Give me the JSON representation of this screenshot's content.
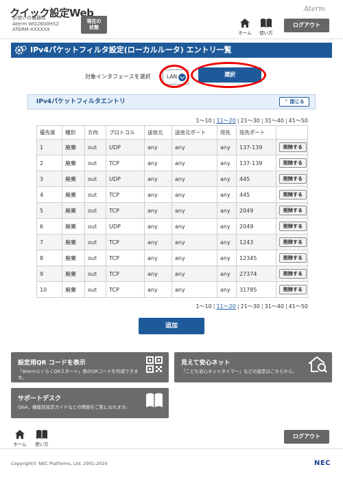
{
  "header": {
    "app_title": "クイック設定Web",
    "device_line1": "お使いの機器は",
    "device_line2": "Aterm WG2600HS2",
    "device_line3": "ATERM-XXXXXX",
    "status_line1": "現在の",
    "status_line2": "状態",
    "brand": "Aterm",
    "home_label": "ホーム",
    "help_label": "使い方",
    "logout_label": "ログアウト"
  },
  "page": {
    "title": "IPv4パケットフィルタ設定(ローカルルータ) エントリ一覧",
    "interface_label": "対象インタフェースを選択",
    "interface_value": "LAN",
    "select_button": "選択"
  },
  "section": {
    "title": "IPv4パケットフィルタエントリ",
    "close_label": "閉じる"
  },
  "pagination": {
    "pages": [
      "1～10",
      "11～20",
      "21～30",
      "31～40",
      "41～50"
    ],
    "linked_index": 1
  },
  "table": {
    "columns": [
      "優先度",
      "種別",
      "方向",
      "プロトコル",
      "送信元",
      "送信元ポート",
      "宛先",
      "宛先ポート",
      ""
    ],
    "delete_label": "削除する",
    "rows": [
      [
        "1",
        "廃棄",
        "out",
        "UDP",
        "any",
        "any",
        "any",
        "137-139"
      ],
      [
        "2",
        "廃棄",
        "out",
        "TCP",
        "any",
        "any",
        "any",
        "137-139"
      ],
      [
        "3",
        "廃棄",
        "out",
        "UDP",
        "any",
        "any",
        "any",
        "445"
      ],
      [
        "4",
        "廃棄",
        "out",
        "TCP",
        "any",
        "any",
        "any",
        "445"
      ],
      [
        "5",
        "廃棄",
        "out",
        "TCP",
        "any",
        "any",
        "any",
        "2049"
      ],
      [
        "6",
        "廃棄",
        "out",
        "UDP",
        "any",
        "any",
        "any",
        "2049"
      ],
      [
        "7",
        "廃棄",
        "out",
        "TCP",
        "any",
        "any",
        "any",
        "1243"
      ],
      [
        "8",
        "廃棄",
        "out",
        "TCP",
        "any",
        "any",
        "any",
        "12345"
      ],
      [
        "9",
        "廃棄",
        "out",
        "TCP",
        "any",
        "any",
        "any",
        "27374"
      ],
      [
        "10",
        "廃棄",
        "out",
        "TCP",
        "any",
        "any",
        "any",
        "31785"
      ]
    ]
  },
  "add_button": "追加",
  "cards": {
    "qr": {
      "title": "設定用QR コードを表示",
      "desc": "「AtermらくらくQRスタート」用のQRコードを作成できます。",
      "icon": "qr-code-icon"
    },
    "safety": {
      "title": "見えて安心ネット",
      "desc": "「こども安心ネットタイマー」などの設定はこちらから。",
      "icon": "house-search-icon"
    },
    "support": {
      "title": "サポートデスク",
      "desc": "Q&A、機能別設定ガイドなどの情報をご覧になれます。",
      "icon": "book-icon"
    }
  },
  "footer": {
    "home_label": "ホーム",
    "help_label": "使い方",
    "logout_label": "ログアウト",
    "copyright": "Copyright© NEC Platforms, Ltd. 2001-2020",
    "logo": "NEC"
  },
  "colors": {
    "primary": "#1e5a99",
    "highlight": "#e00000",
    "card": "#6b6b6b",
    "panel_header": "#e6f0fa"
  }
}
